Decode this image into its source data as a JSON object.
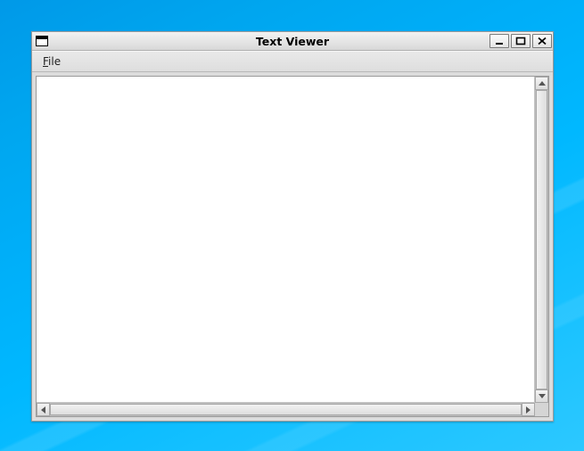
{
  "window": {
    "title": "Text Viewer"
  },
  "menubar": {
    "file_label": "File",
    "file_accel_char": "F"
  },
  "content": {
    "text": ""
  }
}
